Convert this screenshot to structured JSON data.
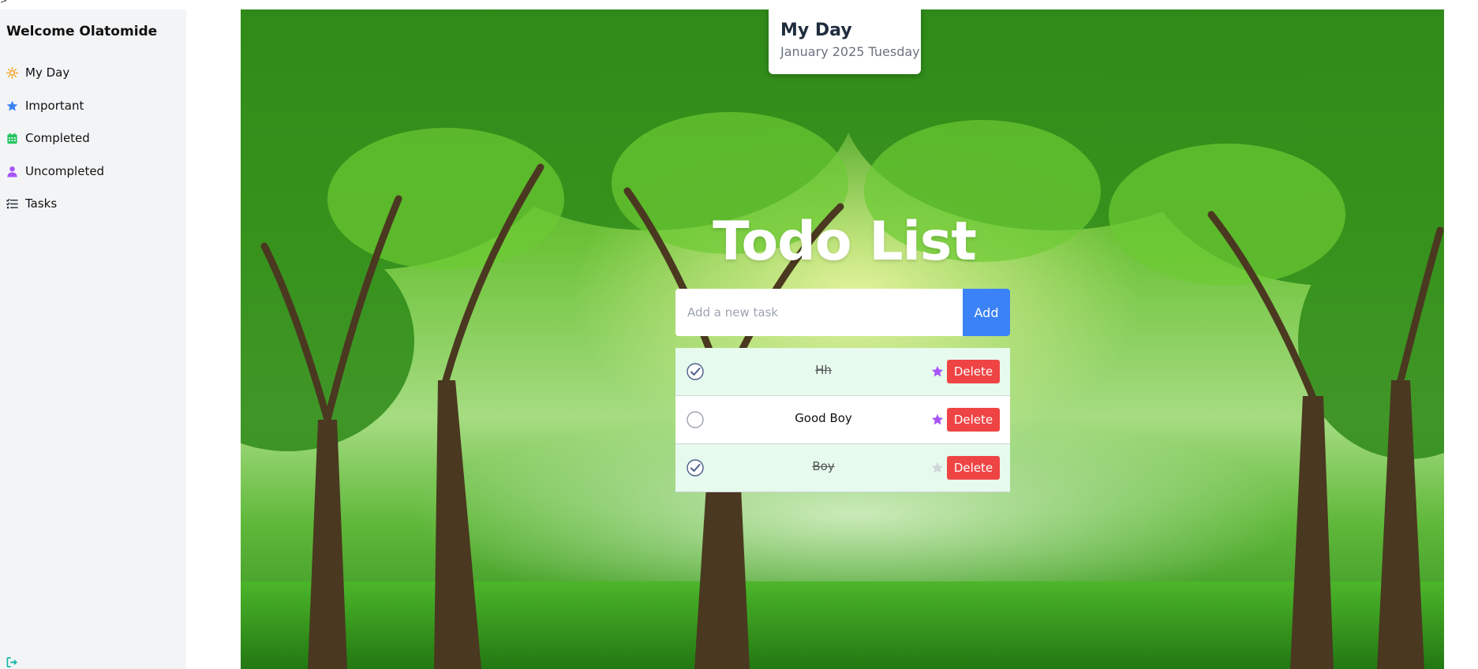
{
  "stray_glyph": ">",
  "sidebar": {
    "welcome": "Welcome Olatomide",
    "items": [
      {
        "label": "My Day",
        "icon": "sun-icon",
        "color": "#f59e0b"
      },
      {
        "label": "Important",
        "icon": "star-icon",
        "color": "#3b82f6"
      },
      {
        "label": "Completed",
        "icon": "calendar-icon",
        "color": "#22c55e"
      },
      {
        "label": "Uncompleted",
        "icon": "user-icon",
        "color": "#a855f7"
      },
      {
        "label": "Tasks",
        "icon": "list-icon",
        "color": "#1f2937"
      }
    ],
    "logout_icon": "logout-icon",
    "logout_color": "#14b8a6"
  },
  "header": {
    "title": "My Day",
    "date": "January 2025 Tuesday"
  },
  "main": {
    "title": "Todo List",
    "input_placeholder": "Add a new task",
    "input_value": "",
    "add_label": "Add"
  },
  "tasks": [
    {
      "text": "Hh",
      "completed": true,
      "important": true,
      "delete_label": "Delete"
    },
    {
      "text": "Good Boy",
      "completed": false,
      "important": true,
      "delete_label": "Delete"
    },
    {
      "text": "Boy",
      "completed": true,
      "important": false,
      "delete_label": "Delete"
    }
  ],
  "colors": {
    "sidebar_bg": "#f3f4f6",
    "add_button": "#3b82f6",
    "delete_button": "#ef4444",
    "star_active": "#a855f7",
    "star_inactive": "#d1d5db",
    "check": "#4b5f8a",
    "completed_row": "#e6faee"
  }
}
